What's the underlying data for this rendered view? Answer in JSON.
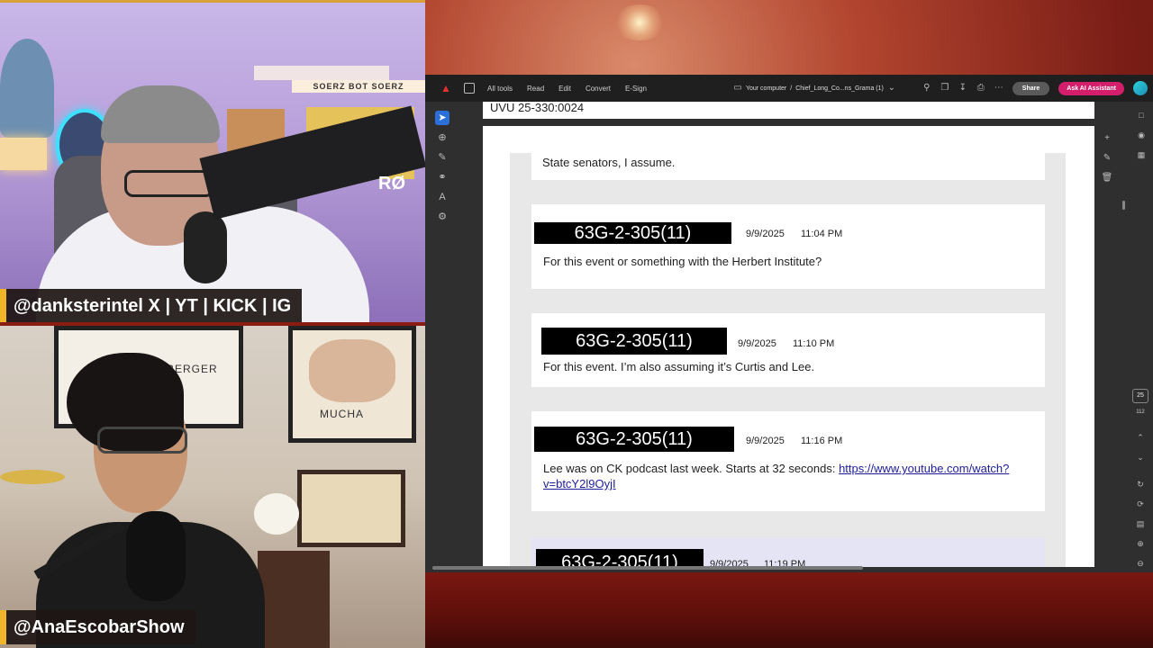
{
  "overlays": {
    "host_handle": "@danksterintel X | YT | KICK | IG",
    "guest_handle": "@AnaEscobarShow",
    "sign_text": "SOERZ BOT SOERZ",
    "mic_text": "RØ",
    "poster_text_left": "BERGER",
    "poster_text_right": "MUCHA"
  },
  "pdf_window": {
    "toolbar": {
      "logo_icon": "acrobat-logo-icon",
      "menu": [
        "All tools",
        "Read",
        "Edit",
        "Convert",
        "E-Sign"
      ],
      "location": "Your computer",
      "separator": "/",
      "filename": "Chief_Long_Co...ns_Grama (1)",
      "share_label": "Share",
      "ai_label": "Ask AI Assistant"
    },
    "page_header": "UVU 25-330:0024",
    "page_indicator": "25",
    "page_total": "112",
    "messages": [
      {
        "text": "State senators, I assume.",
        "sender": "",
        "date": "",
        "time": ""
      },
      {
        "sender": "63G-2-305(11)",
        "date": "9/9/2025",
        "time": "11:04 PM",
        "text": "For this event or something with the Herbert Institute?"
      },
      {
        "sender": "63G-2-305(11)",
        "date": "9/9/2025",
        "time": "11:10 PM",
        "text": "For this event. I’m also assuming it’s Curtis and Lee."
      },
      {
        "sender": "63G-2-305(11)",
        "date": "9/9/2025",
        "time": "11:16 PM",
        "text": "Lee was on CK podcast last week. Starts at 32 seconds: ",
        "link": "https://www.youtube.com/watch?v=btcY2l9OyjI"
      },
      {
        "sender": "63G-2-305(11)",
        "date": "9/9/2025",
        "time": "11:19 PM",
        "text": ""
      }
    ]
  }
}
